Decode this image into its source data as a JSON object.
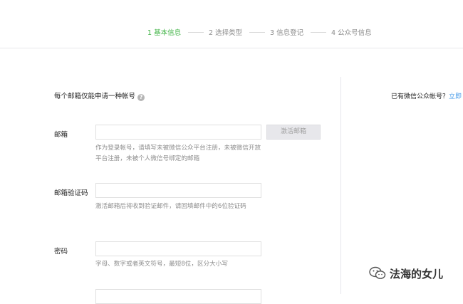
{
  "steps": [
    {
      "label": "1 基本信息",
      "active": true
    },
    {
      "label": "2 选择类型",
      "active": false
    },
    {
      "label": "3 信息登记",
      "active": false
    },
    {
      "label": "4 公众号信息",
      "active": false
    }
  ],
  "form": {
    "intro": "每个邮箱仅能申请一种帐号",
    "help_icon": "?",
    "email": {
      "label": "邮箱",
      "hint": "作为登录帐号，请填写未被微信公众平台注册，未被微信开放平台注册，未被个人微信号绑定的邮箱",
      "activate_button": "激活邮箱"
    },
    "code": {
      "label": "邮箱验证码",
      "hint": "激活邮箱后将收到验证邮件，请回填邮件中的6位验证码"
    },
    "password": {
      "label": "密码",
      "hint": "字母、数字或者英文符号，最短8位，区分大小写"
    }
  },
  "aside": {
    "text": "已有微信公众帐号？",
    "link": "立即"
  },
  "watermark": {
    "text": "法海的女儿",
    "icon": "wechat-icon"
  },
  "colors": {
    "active_step": "#44b549",
    "link": "#459ae9"
  }
}
